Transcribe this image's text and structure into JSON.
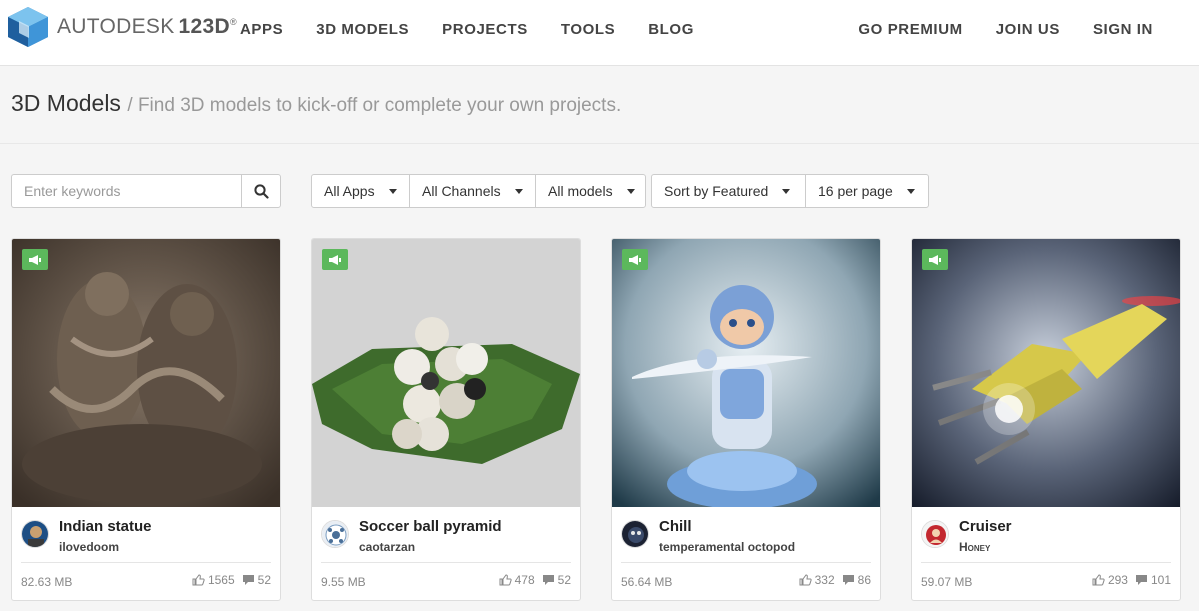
{
  "brand": {
    "name": "AUTODESK",
    "product": "123D",
    "mark": "®"
  },
  "nav": {
    "left": [
      "APPS",
      "3D MODELS",
      "PROJECTS",
      "TOOLS",
      "BLOG"
    ],
    "right": [
      "GO PREMIUM",
      "JOIN US",
      "SIGN IN"
    ]
  },
  "page": {
    "title": "3D Models",
    "subtitle": "/ Find 3D models to kick-off or complete your own projects."
  },
  "search": {
    "placeholder": "Enter keywords",
    "value": ""
  },
  "filters": {
    "apps": "All Apps",
    "channels": "All Channels",
    "models": "All models",
    "sort": "Sort by Featured",
    "per_page": "16 per page"
  },
  "colors": {
    "badge": "#5cb85c",
    "logo_blue": "#3a8fd0"
  },
  "cards": [
    {
      "name": "Indian statue",
      "author": "ilovedoom",
      "size": "82.63 MB",
      "likes": "1565",
      "comments": "52"
    },
    {
      "name": "Soccer ball pyramid",
      "author": "caotarzan",
      "size": "9.55 MB",
      "likes": "478",
      "comments": "52"
    },
    {
      "name": "Chill",
      "author": "temperamental octopod",
      "size": "56.64 MB",
      "likes": "332",
      "comments": "86"
    },
    {
      "name": "Cruiser",
      "author": "Honey",
      "size": "59.07 MB",
      "likes": "293",
      "comments": "101"
    }
  ]
}
